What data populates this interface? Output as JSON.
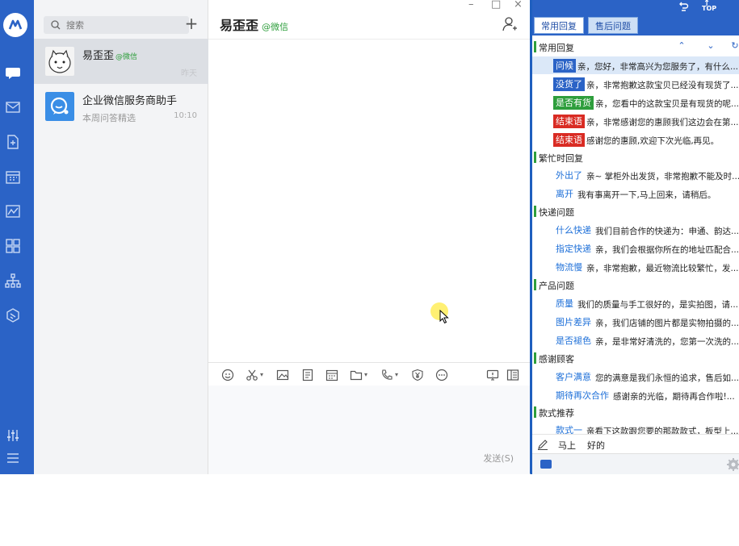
{
  "colors": {
    "rail": "#2b63c6",
    "accent_green": "#2e9e3c",
    "badge_red": "#d92b23",
    "badge_blue": "#2b63c6"
  },
  "search": {
    "placeholder": "搜索"
  },
  "rail_icons": [
    "logo-icon",
    "chat-icon",
    "mail-icon",
    "document-icon",
    "calendar-icon",
    "chart-icon",
    "apps-icon",
    "org-icon",
    "cube-icon",
    "settings-sliders-icon",
    "menu-icon"
  ],
  "window_controls": {
    "minimize": "–",
    "maximize": "□",
    "close": "×"
  },
  "conversations": [
    {
      "name": "易歪歪",
      "tag": "@微信",
      "preview": "",
      "time": "昨天"
    },
    {
      "name": "企业微信服务商助手",
      "tag": "",
      "preview": "本周问答精选",
      "time": "10:10"
    }
  ],
  "chat": {
    "title": "易歪歪",
    "subtitle": "@微信",
    "send_label": "发送(S)",
    "toolbar_icons": [
      "emoji-icon",
      "scissors-icon",
      "image-icon",
      "document-icon",
      "calendar-icon",
      "folder-icon",
      "phone-icon",
      "shield-yen-icon",
      "more-icon",
      "screen-share-icon",
      "sidebar-icon"
    ]
  },
  "side": {
    "top_icons": [
      "refresh-icon",
      "top-icon"
    ],
    "top_label": "TOP",
    "tabs": [
      "常用回复",
      "售后问题"
    ],
    "categories": [
      {
        "label": "常用回复",
        "items": [
          {
            "key": "问候",
            "style": "b-blue",
            "text": "亲，您好，非常高兴为您服务了，有什么..."
          },
          {
            "key": "没货了",
            "style": "b-blue",
            "text": "亲，非常抱歉这款宝贝已经没有现货了..."
          },
          {
            "key": "是否有货",
            "style": "b-green",
            "text": "亲，您看中的这款宝贝是有现货的呢..."
          },
          {
            "key": "结束语",
            "style": "b-red",
            "text": "亲，非常感谢您的惠顾我们这边会在第..."
          },
          {
            "key": "结束语",
            "style": "b-red",
            "text": "感谢您的惠顾,欢迎下次光临,再见。"
          }
        ]
      },
      {
        "label": "繁忙时回复",
        "items": [
          {
            "key": "外出了",
            "style": "",
            "text": "亲~ 掌柜外出发货，非常抱歉不能及时..."
          },
          {
            "key": "离开",
            "style": "",
            "text": "我有事离开一下,马上回来，请稍后。"
          }
        ]
      },
      {
        "label": "快递问题",
        "items": [
          {
            "key": "什么快递",
            "style": "",
            "text": "我们目前合作的快递为：申通、韵达..."
          },
          {
            "key": "指定快递",
            "style": "",
            "text": "亲，我们会根据你所在的地址匹配合..."
          },
          {
            "key": "物流慢",
            "style": "",
            "text": "亲，非常抱歉，最近物流比较繁忙，发..."
          }
        ]
      },
      {
        "label": "产品问题",
        "items": [
          {
            "key": "质量",
            "style": "",
            "text": "我们的质量与手工很好的，是实拍图，请..."
          },
          {
            "key": "图片差异",
            "style": "",
            "text": "亲，我们店铺的图片都是实物拍摄的..."
          },
          {
            "key": "是否褪色",
            "style": "",
            "text": "亲，是非常好清洗的，您第一次洗的..."
          }
        ]
      },
      {
        "label": "感谢顾客",
        "items": [
          {
            "key": "客户满意",
            "style": "",
            "text": "您的满意是我们永恒的追求，售后如..."
          },
          {
            "key": "期待再次合作",
            "style": "",
            "text": "感谢亲的光临，期待再合作啦!..."
          }
        ]
      },
      {
        "label": "款式推荐",
        "items": [
          {
            "key": "款式一",
            "style": "",
            "text": "亲看下这款跟您要的那款款式，板型上..."
          }
        ]
      }
    ],
    "footer_words": [
      "马上",
      "好的"
    ]
  }
}
